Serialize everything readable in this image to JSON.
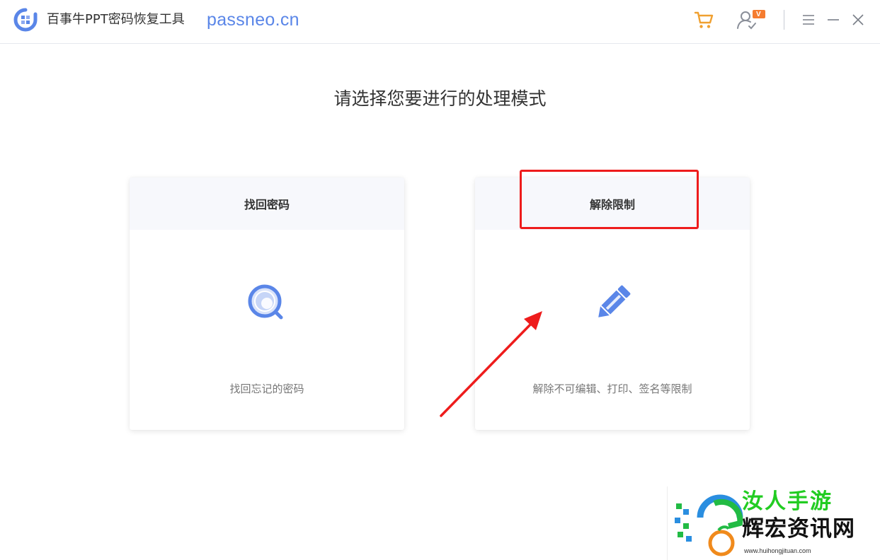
{
  "titlebar": {
    "app_name": "百事牛PPT密码恢复工具",
    "domain": "passneo.cn",
    "icons": [
      "app-logo-icon",
      "cart-icon",
      "user-vip-icon",
      "menu-icon",
      "minimize-icon",
      "close-icon"
    ],
    "vip_badge": "V"
  },
  "main": {
    "heading": "请选择您要进行的处理模式"
  },
  "cards": [
    {
      "title": "找回密码",
      "icon": "search-magnifier-icon",
      "description": "找回忘记的密码"
    },
    {
      "title": "解除限制",
      "icon": "pencil-edit-icon",
      "description": "解除不可编辑、打印、签名等限制"
    }
  ],
  "annotation": {
    "highlight_color": "#ee1c1c",
    "arrow_color": "#ee1c1c"
  },
  "watermark": {
    "line1": "汝人手游",
    "line2": "辉宏资讯网",
    "url": "www.huihongjituan.com"
  },
  "colors": {
    "accent": "#5a86e8",
    "cart": "#f0a030",
    "vip": "#f57c30",
    "card_header_bg": "#f7f8fc"
  }
}
